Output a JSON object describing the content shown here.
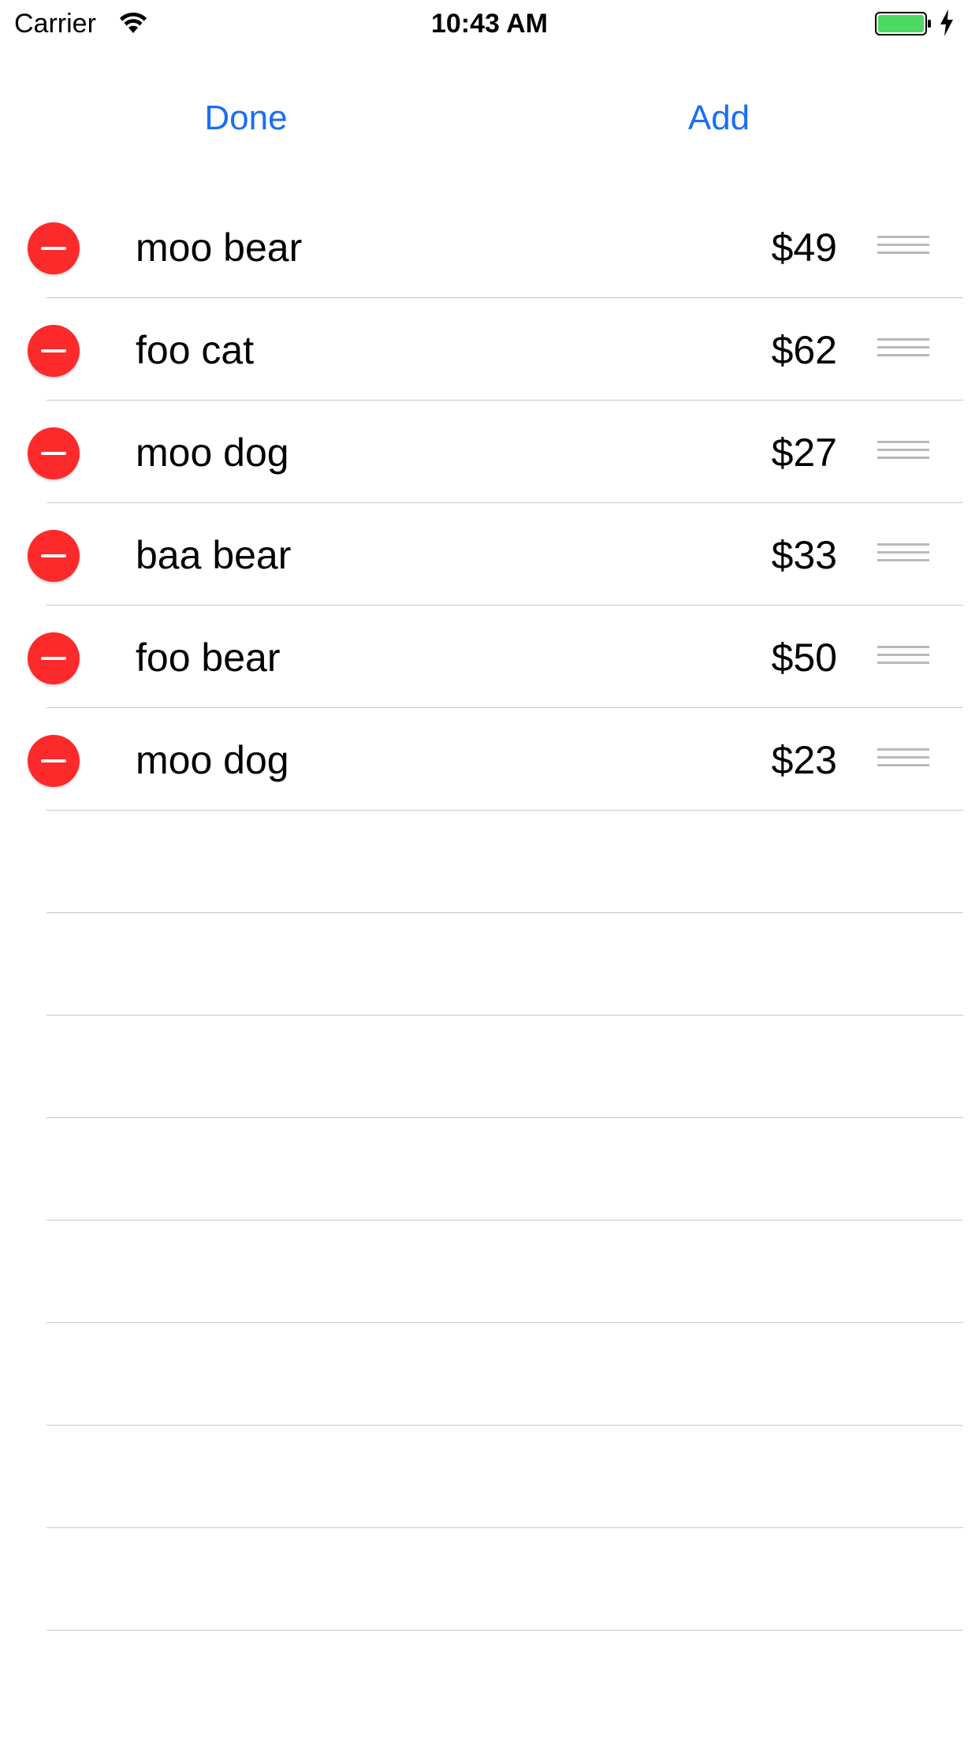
{
  "status_bar": {
    "carrier": "Carrier",
    "time": "10:43 AM",
    "battery_color": "#4cd964"
  },
  "toolbar": {
    "done_label": "Done",
    "add_label": "Add",
    "accent_color": "#1a6ef5"
  },
  "items": [
    {
      "name": "moo bear",
      "price": "$49"
    },
    {
      "name": "foo cat",
      "price": "$62"
    },
    {
      "name": "moo dog",
      "price": "$27"
    },
    {
      "name": "baa bear",
      "price": "$33"
    },
    {
      "name": "foo bear",
      "price": "$50"
    },
    {
      "name": "moo dog",
      "price": "$23"
    }
  ],
  "delete_color": "#fc2a2a"
}
